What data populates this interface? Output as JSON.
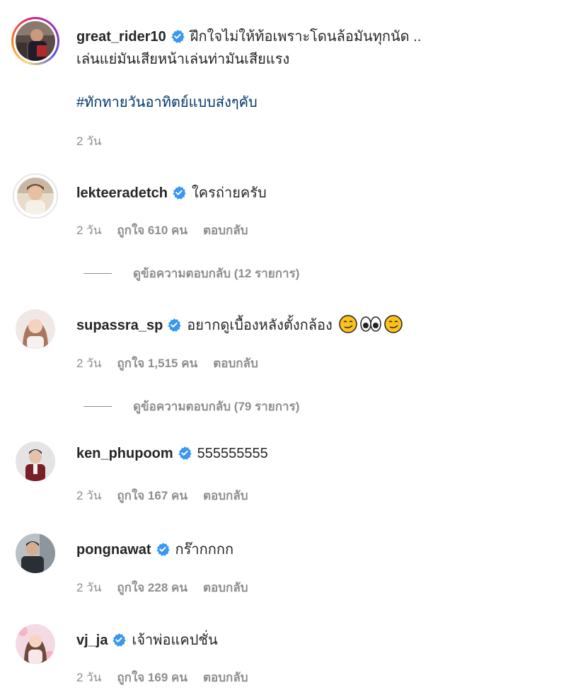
{
  "comments": [
    {
      "username": "great_rider10",
      "text": "ฝึกใจไม่ให้ท้อเพราะโดนล้อมันทุกนัด ..",
      "text_line2": "เล่นแย่มันเสียหน้าเล่นท่ามันเสียแรง",
      "hashtag": "#ทักทายวันอาทิตย์แบบส่งๆคับ",
      "time": "2 วัน"
    },
    {
      "username": "lekteeradetch",
      "text": "ใครถ่ายครับ",
      "time": "2 วัน",
      "likes": "ถูกใจ 610 คน",
      "reply": "ตอบกลับ",
      "view_replies": "ดูข้อความตอบกลับ (12 รายการ)"
    },
    {
      "username": "supassra_sp",
      "text": "อยากดูเบื้องหลังตั้งกล้อง",
      "time": "2 วัน",
      "likes": "ถูกใจ 1,515 คน",
      "reply": "ตอบกลับ",
      "view_replies": "ดูข้อความตอบกลับ (79 รายการ)"
    },
    {
      "username": "ken_phupoom",
      "text": "555555555",
      "time": "2 วัน",
      "likes": "ถูกใจ 167 คน",
      "reply": "ตอบกลับ"
    },
    {
      "username": "pongnawat",
      "text": "กร๊ากกกก",
      "time": "2 วัน",
      "likes": "ถูกใจ 228 คน",
      "reply": "ตอบกลับ"
    },
    {
      "username": "vj_ja",
      "text": "เจ้าพ่อแคปชั่น",
      "time": "2 วัน",
      "likes": "ถูกใจ 169 คน",
      "reply": "ตอบกลับ"
    }
  ],
  "icons": {
    "verified": "verified-badge-icon",
    "emojis": [
      "smirking-face",
      "eyes",
      "smirking-face"
    ]
  },
  "colors": {
    "verified": "#3897f0",
    "hashtag": "#00376b",
    "meta": "#8e8e8e"
  }
}
